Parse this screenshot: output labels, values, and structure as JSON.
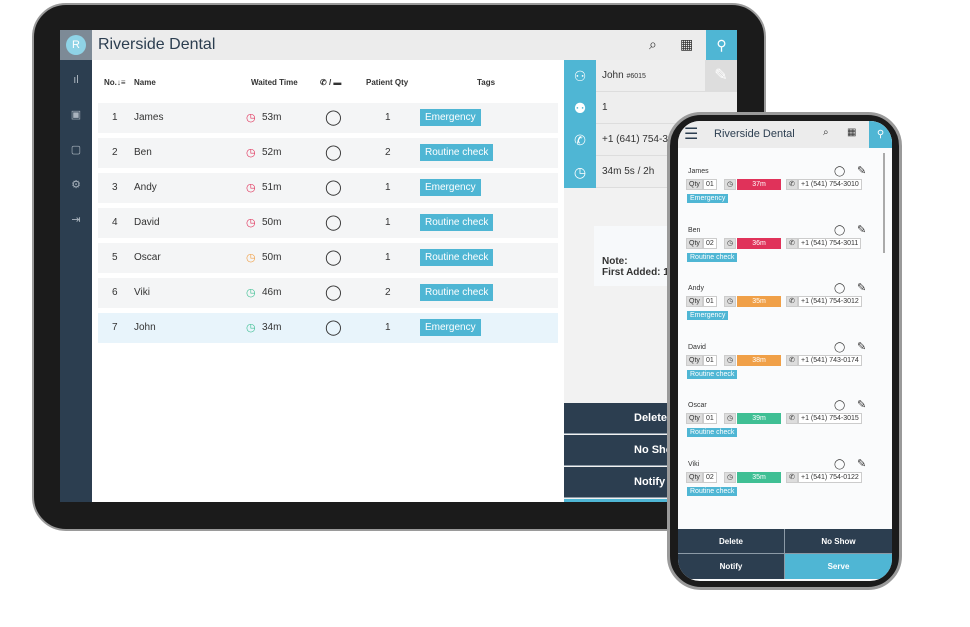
{
  "app": {
    "title": "Riverside Dental",
    "logo_letter": "R"
  },
  "table": {
    "headers": {
      "no": "No.",
      "name": "Name",
      "waited": "Waited Time",
      "contact": "/",
      "qty": "Patient Qty",
      "tags": "Tags"
    },
    "rows": [
      {
        "no": "1",
        "name": "James",
        "waited": "53m",
        "qty": "1",
        "tag": "Emergency",
        "clock_color": "#e0325a"
      },
      {
        "no": "2",
        "name": "Ben",
        "waited": "52m",
        "qty": "2",
        "tag": "Routine check",
        "clock_color": "#e0325a"
      },
      {
        "no": "3",
        "name": "Andy",
        "waited": "51m",
        "qty": "1",
        "tag": "Emergency",
        "clock_color": "#e0325a"
      },
      {
        "no": "4",
        "name": "David",
        "waited": "50m",
        "qty": "1",
        "tag": "Routine check",
        "clock_color": "#e0325a"
      },
      {
        "no": "5",
        "name": "Oscar",
        "waited": "50m",
        "qty": "1",
        "tag": "Routine check",
        "clock_color": "#f0a048"
      },
      {
        "no": "6",
        "name": "Viki",
        "waited": "46m",
        "qty": "2",
        "tag": "Routine check",
        "clock_color": "#3fbf94"
      },
      {
        "no": "7",
        "name": "John",
        "waited": "34m",
        "qty": "1",
        "tag": "Emergency",
        "clock_color": "#3fbf94"
      }
    ]
  },
  "detail": {
    "name": "John",
    "id": "#6015",
    "qty": "1",
    "phone": "+1 (641) 754-30",
    "time": "34m 5s  / 2h",
    "note_label": "Note:",
    "first_added_label": "First Added: 1"
  },
  "actions": {
    "delete": "Delete",
    "no_show": "No Show",
    "notify": "Notify",
    "serve": "Serve"
  },
  "phone": {
    "qty_label": "Qty",
    "cards": [
      {
        "name": "James",
        "qty": "01",
        "time": "37m",
        "phone": "+1 (541) 754-3010",
        "tag": "Emergency",
        "color": "#e0325a"
      },
      {
        "name": "Ben",
        "qty": "02",
        "time": "36m",
        "phone": "+1 (541) 754-3011",
        "tag": "Routine check",
        "color": "#e0325a"
      },
      {
        "name": "Andy",
        "qty": "01",
        "time": "35m",
        "phone": "+1 (541) 754-3012",
        "tag": "Emergency",
        "color": "#f0a048"
      },
      {
        "name": "David",
        "qty": "01",
        "time": "38m",
        "phone": "+1 (541) 743-0174",
        "tag": "Routine check",
        "color": "#f0a048"
      },
      {
        "name": "Oscar",
        "qty": "01",
        "time": "39m",
        "phone": "+1 (541) 754-3015",
        "tag": "Routine check",
        "color": "#3fbf94"
      },
      {
        "name": "Viki",
        "qty": "02",
        "time": "35m",
        "phone": "+1 (541) 754-0122",
        "tag": "Routine check",
        "color": "#3fbf94"
      }
    ]
  },
  "colors": {
    "accent": "#4fb6d4",
    "sidebar": "#2c3e50"
  }
}
